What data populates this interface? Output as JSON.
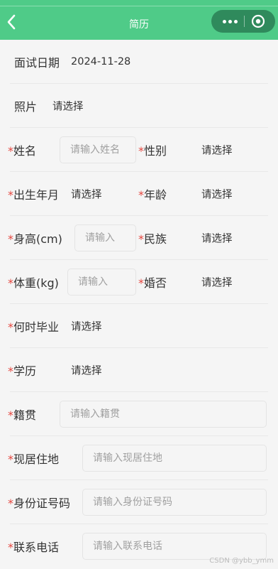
{
  "header": {
    "title": "简历"
  },
  "colors": {
    "header_bg": "#4fcb88",
    "capsule_bg": "#2f8a5c",
    "required_star": "#e5463f"
  },
  "form": {
    "interview_date": {
      "label": "面试日期",
      "value": "2024-11-28"
    },
    "photo": {
      "label": "照片",
      "value": "请选择"
    },
    "name": {
      "label": "姓名",
      "placeholder": "请输入姓名"
    },
    "gender": {
      "label": "性别",
      "value": "请选择"
    },
    "birth": {
      "label": "出生年月",
      "value": "请选择"
    },
    "age": {
      "label": "年龄",
      "value": "请选择"
    },
    "height": {
      "label": "身高(cm)",
      "placeholder": "请输入"
    },
    "ethnicity": {
      "label": "民族",
      "value": "请选择"
    },
    "weight": {
      "label": "体重(kg)",
      "placeholder": "请输入"
    },
    "marital": {
      "label": "婚否",
      "value": "请选择"
    },
    "graduation": {
      "label": "何时毕业",
      "value": "请选择"
    },
    "education": {
      "label": "学历",
      "value": "请选择"
    },
    "native_place": {
      "label": "籍贯",
      "placeholder": "请输入籍贯"
    },
    "residence": {
      "label": "现居住地",
      "placeholder": "请输入现居住地"
    },
    "id_number": {
      "label": "身份证号码",
      "placeholder": "请输入身份证号码"
    },
    "phone": {
      "label": "联系电话",
      "placeholder": "请输入联系电话"
    }
  },
  "watermark": "CSDN @ybb_ymm"
}
